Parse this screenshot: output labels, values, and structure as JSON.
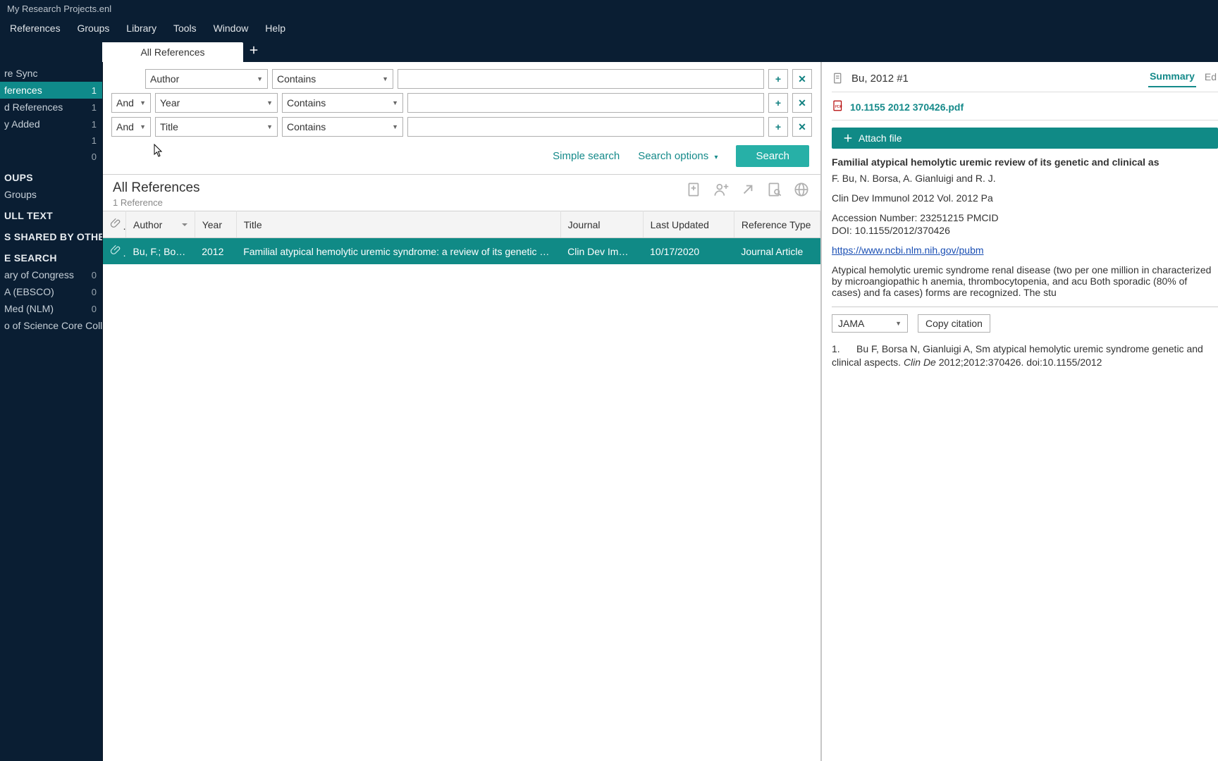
{
  "window": {
    "title": "My Research Projects.enl"
  },
  "menu": {
    "items": [
      "References",
      "Groups",
      "Library",
      "Tools",
      "Window",
      "Help"
    ]
  },
  "sidebar": {
    "sync": "re Sync",
    "items": [
      {
        "label": "ferences",
        "count": "1"
      },
      {
        "label": "d References",
        "count": "1"
      },
      {
        "label": "y Added",
        "count": "1"
      },
      {
        "label": "",
        "count": "1"
      },
      {
        "label": "",
        "count": "0"
      }
    ],
    "groups_header": "OUPS",
    "groups_item": "Groups",
    "fulltext_header": "ULL TEXT",
    "shared_header": "S SHARED BY OTHERS",
    "search_header": "E SEARCH",
    "sources": [
      {
        "label": "ary of Congress",
        "count": "0"
      },
      {
        "label": "A (EBSCO)",
        "count": "0"
      },
      {
        "label": "Med (NLM)",
        "count": "0"
      },
      {
        "label": "o of Science Core Colle...",
        "count": "0"
      }
    ]
  },
  "tabs": {
    "active": "All References"
  },
  "search": {
    "rows": [
      {
        "bool": "",
        "field": "Author",
        "op": "Contains",
        "value": ""
      },
      {
        "bool": "And",
        "field": "Year",
        "op": "Contains",
        "value": ""
      },
      {
        "bool": "And",
        "field": "Title",
        "op": "Contains",
        "value": ""
      }
    ],
    "simple": "Simple search",
    "options": "Search options",
    "search_btn": "Search"
  },
  "results": {
    "heading": "All References",
    "subheading": "1 Reference",
    "columns": {
      "attach": "",
      "author": "Author",
      "year": "Year",
      "title": "Title",
      "journal": "Journal",
      "updated": "Last Updated",
      "reftype": "Reference Type"
    },
    "rows": [
      {
        "attach_icon": "paperclip",
        "author": "Bu, F.; Borsa, ...",
        "year": "2012",
        "title": "Familial atypical hemolytic uremic syndrome: a review of its genetic and clinical ...",
        "journal": "Clin Dev Immunol",
        "updated": "10/17/2020",
        "reftype": "Journal Article"
      }
    ]
  },
  "preview": {
    "ref_id": "Bu, 2012 #1",
    "tabs": {
      "summary": "Summary",
      "edit": "Ed"
    },
    "pdf": {
      "name": "10.1155 2012 370426.pdf"
    },
    "attach_label": "Attach file",
    "title": "Familial atypical hemolytic uremic review of its genetic and clinical as",
    "authors": "F. Bu, N. Borsa, A. Gianluigi and R. J.",
    "journal_line": "Clin Dev Immunol 2012 Vol. 2012 Pa",
    "accession": "Accession Number: 23251215 PMCID",
    "doi": "DOI: 10.1155/2012/370426",
    "url": "https://www.ncbi.nlm.nih.gov/pubm",
    "abstract": "Atypical hemolytic uremic syndrome renal disease (two per one million in characterized by microangiopathic h anemia, thrombocytopenia, and acu Both sporadic (80% of cases) and fa cases) forms are recognized. The stu",
    "cite_style": "JAMA",
    "copy_label": "Copy citation",
    "citation_num": "1.",
    "citation_body": "Bu F, Borsa N, Gianluigi A, Sm atypical hemolytic uremic syndrome genetic and clinical aspects. ",
    "citation_journal": "Clin De",
    "citation_tail": " 2012;2012:370426. doi:10.1155/2012"
  }
}
